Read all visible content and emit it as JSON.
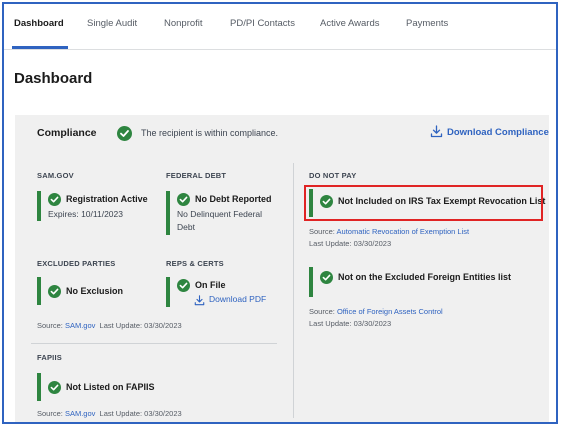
{
  "tabs": [
    "Dashboard",
    "Single Audit",
    "Nonprofit",
    "PD/PI Contacts",
    "Active Awards",
    "Payments"
  ],
  "page_title": "Dashboard",
  "compliance": {
    "title": "Compliance",
    "status_text": "The recipient is within compliance.",
    "download_label": "Download Compliance"
  },
  "sam": {
    "label": "SAM.GOV",
    "status": "Registration Active",
    "expires": "Expires: 10/11/2023"
  },
  "federal_debt": {
    "label": "FEDERAL DEBT",
    "status": "No Debt Reported",
    "detail_line1": "No Delinquent Federal",
    "detail_line2": "Debt"
  },
  "excluded_parties": {
    "label": "EXCLUDED PARTIES",
    "status": "No Exclusion"
  },
  "reps_certs": {
    "label": "REPS & CERTS",
    "status": "On File",
    "download_label": "Download PDF"
  },
  "source_sam": {
    "prefix": "Source: ",
    "link": "SAM.gov",
    "update": "Last Update: 03/30/2023"
  },
  "fapiis": {
    "label": "FAPIIS",
    "status": "Not Listed on FAPIIS",
    "source_prefix": "Source: ",
    "source_link": "SAM.gov",
    "update": "Last Update: 03/30/2023"
  },
  "do_not_pay": {
    "label": "DO NOT PAY",
    "irs_status": "Not Included on IRS Tax Exempt Revocation List",
    "irs_source_prefix": "Source: ",
    "irs_source_link": "Automatic Revocation of Exemption List",
    "irs_update": "Last Update: 03/30/2023",
    "foreign_status": "Not on the Excluded Foreign Entities list",
    "foreign_source_prefix": "Source: ",
    "foreign_source_link": "Office of Foreign Assets Control",
    "foreign_update": "Last Update: 03/30/2023"
  },
  "colors": {
    "accent": "#2f63c0",
    "success": "#2e8540",
    "highlight": "#e02424",
    "card_bg": "#f0f0f0"
  },
  "icons": [
    "check-circle-icon",
    "download-icon"
  ]
}
